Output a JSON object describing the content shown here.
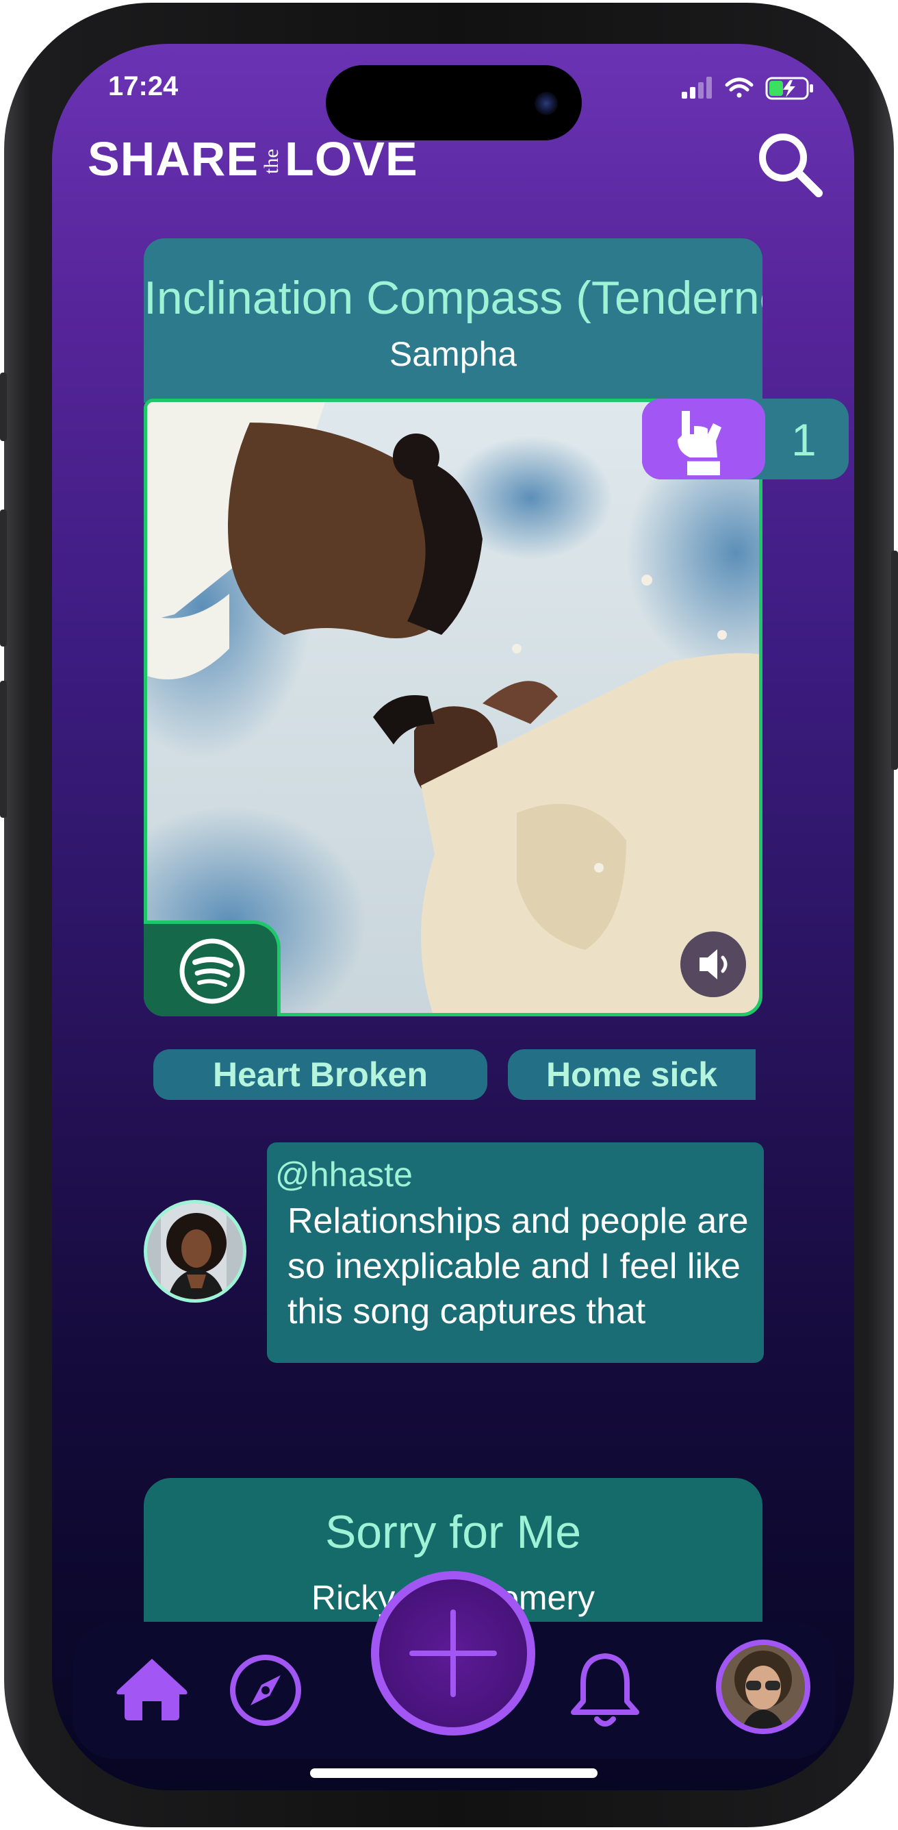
{
  "status_bar": {
    "time": "17:24"
  },
  "header": {
    "logo_share": "SHARE",
    "logo_the": "the",
    "logo_love": "LOVE"
  },
  "post": {
    "song_title": "Inclination Compass (Tenderness)",
    "artist": "Sampha",
    "reaction_count": "1",
    "tags": [
      "Heart Broken",
      "Home sick"
    ],
    "comment": {
      "username": "@hhaste",
      "text": "Relationships and people are so inexplicable and I feel like this song captures that"
    }
  },
  "next_post": {
    "song_title": "Sorry for Me",
    "artist": "Ricky Montgomery"
  },
  "tab_bar": {
    "items": [
      "home-icon",
      "compass-icon",
      "add-icon",
      "bell-icon",
      "profile-avatar"
    ],
    "accent": "#a257f4"
  },
  "colors": {
    "mint": "#9ef2d6",
    "teal_card": "#2c7a8c",
    "spotify_green": "#1ec767",
    "purple_accent": "#a257f4"
  }
}
